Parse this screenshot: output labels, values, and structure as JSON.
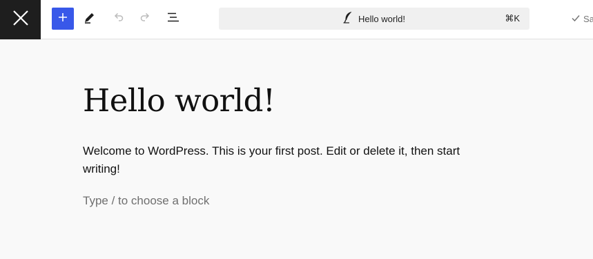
{
  "toolbar": {
    "close_icon": "close-icon",
    "add_icon": "plus-icon",
    "add_color": "#3858e9",
    "tools": [
      {
        "icon": "pencil-icon",
        "state": "active"
      },
      {
        "icon": "undo-icon",
        "state": "disabled"
      },
      {
        "icon": "redo-icon",
        "state": "disabled"
      },
      {
        "icon": "document-overview-icon",
        "state": "active"
      }
    ],
    "command_bar": {
      "icon": "quill-icon",
      "title": "Hello world!",
      "shortcut": "⌘K"
    },
    "save_status": {
      "icon": "check-icon",
      "label": "Sa"
    }
  },
  "editor": {
    "title": "Hello world!",
    "paragraph": "Welcome to WordPress. This is your first post. Edit or delete it, then start writing!",
    "placeholder": "Type / to choose a block"
  }
}
